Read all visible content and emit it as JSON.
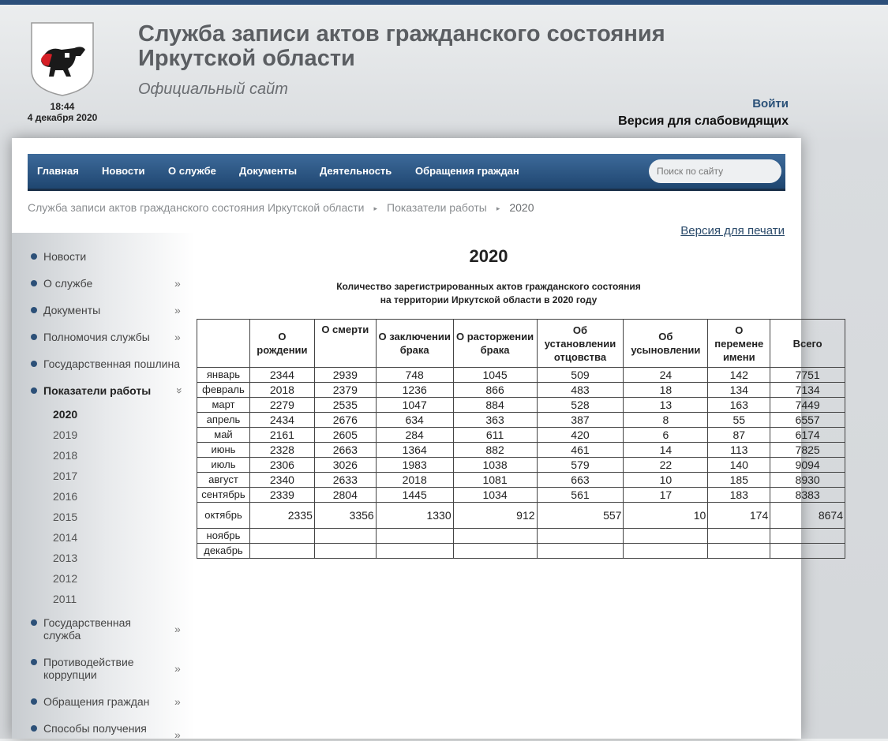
{
  "header": {
    "title_line1": "Служба записи актов гражданского состояния",
    "title_line2": "Иркутской области",
    "subtitle": "Официальный сайт",
    "time": "18:44",
    "date": "4 декабря 2020",
    "login": "Войти",
    "low_vision": "Версия для слабовидящих"
  },
  "nav": {
    "items": [
      "Главная",
      "Новости",
      "О службе",
      "Документы",
      "Деятельность",
      "Обращения граждан"
    ],
    "search_placeholder": "Поиск по сайту"
  },
  "breadcrumb": {
    "items": [
      "Служба записи актов гражданского состояния Иркутской области",
      "Показатели работы",
      "2020"
    ],
    "separator": "▸"
  },
  "print_link": "Версия для печати",
  "sidebar": {
    "items": [
      {
        "label": "Новости",
        "arrow": ""
      },
      {
        "label": "О службе",
        "arrow": "»"
      },
      {
        "label": "Документы",
        "arrow": "»"
      },
      {
        "label": "Полномочия службы",
        "arrow": "»"
      },
      {
        "label": "Государственная пошлина",
        "arrow": ""
      },
      {
        "label": "Показатели работы",
        "arrow": "»"
      },
      {
        "label": "Государственная служба",
        "arrow": "»"
      },
      {
        "label": "Противодействие коррупции",
        "arrow": "»"
      },
      {
        "label": "Обращения граждан",
        "arrow": "»"
      },
      {
        "label": "Способы получения",
        "arrow": "»"
      }
    ],
    "years": [
      "2020",
      "2019",
      "2018",
      "2017",
      "2016",
      "2015",
      "2014",
      "2013",
      "2012",
      "2011"
    ]
  },
  "content": {
    "title": "2020",
    "caption_line1": "Количество зарегистрированных актов гражданского состояния",
    "caption_line2": "на территории Иркутской области в 2020 году"
  },
  "table": {
    "headers": [
      "",
      "О рождении",
      "О смерти",
      "О заключении брака",
      "О расторжении брака",
      "Об установлении отцовства",
      "Об усыновлении",
      "О перемене имени",
      "Всего"
    ],
    "rows": [
      [
        "январь",
        "2344",
        "2939",
        "748",
        "1045",
        "509",
        "24",
        "142",
        "7751"
      ],
      [
        "февраль",
        "2018",
        "2379",
        "1236",
        "866",
        "483",
        "18",
        "134",
        "7134"
      ],
      [
        "март",
        "2279",
        "2535",
        "1047",
        "884",
        "528",
        "13",
        "163",
        "7449"
      ],
      [
        "апрель",
        "2434",
        "2676",
        "634",
        "363",
        "387",
        "8",
        "55",
        "6557"
      ],
      [
        "май",
        "2161",
        "2605",
        "284",
        "611",
        "420",
        "6",
        "87",
        "6174"
      ],
      [
        "июнь",
        "2328",
        "2663",
        "1364",
        "882",
        "461",
        "14",
        "113",
        "7825"
      ],
      [
        "июль",
        "2306",
        "3026",
        "1983",
        "1038",
        "579",
        "22",
        "140",
        "9094"
      ],
      [
        "август",
        "2340",
        "2633",
        "2018",
        "1081",
        "663",
        "10",
        "185",
        "8930"
      ],
      [
        "сентябрь",
        "2339",
        "2804",
        "1445",
        "1034",
        "561",
        "17",
        "183",
        "8383"
      ],
      [
        "октябрь",
        "2335",
        "3356",
        "1330",
        "912",
        "557",
        "10",
        "174",
        "8674"
      ],
      [
        "ноябрь",
        "",
        "",
        "",
        "",
        "",
        "",
        "",
        ""
      ],
      [
        "декабрь",
        "",
        "",
        "",
        "",
        "",
        "",
        "",
        ""
      ]
    ]
  },
  "colors": {
    "nav_top": "#3d6a9a",
    "nav_bottom": "#1f4670",
    "accent": "#2c5078",
    "emblem_red": "#d51f26"
  }
}
